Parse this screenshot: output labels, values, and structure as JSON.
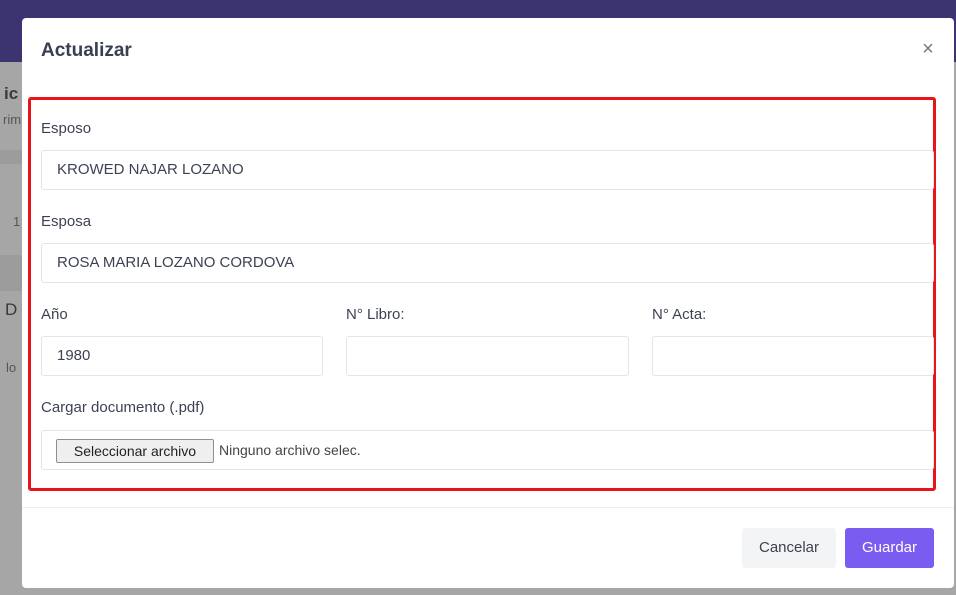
{
  "background": {
    "fragments": [
      {
        "text": "ic"
      },
      {
        "text": "rim"
      },
      {
        "text": "1"
      },
      {
        "text": "D"
      },
      {
        "text": "lo"
      }
    ]
  },
  "modal": {
    "title": "Actualizar",
    "close_icon": "close-icon",
    "fields": {
      "esposo": {
        "label": "Esposo",
        "value": "KROWED NAJAR LOZANO"
      },
      "esposa": {
        "label": "Esposa",
        "value": "ROSA MARIA LOZANO CORDOVA"
      },
      "anio": {
        "label": "Año",
        "value": "1980"
      },
      "libro": {
        "label": "N° Libro:",
        "value": ""
      },
      "acta": {
        "label": "N° Acta:",
        "value": ""
      },
      "documento": {
        "label": "Cargar documento (.pdf)",
        "button_label": "Seleccionar archivo",
        "status": "Ninguno archivo selec."
      }
    },
    "footer": {
      "cancel_label": "Cancelar",
      "save_label": "Guardar"
    }
  },
  "colors": {
    "topbar": "#3b3470",
    "highlight": "#e8141b",
    "primary": "#7b5cf0"
  }
}
